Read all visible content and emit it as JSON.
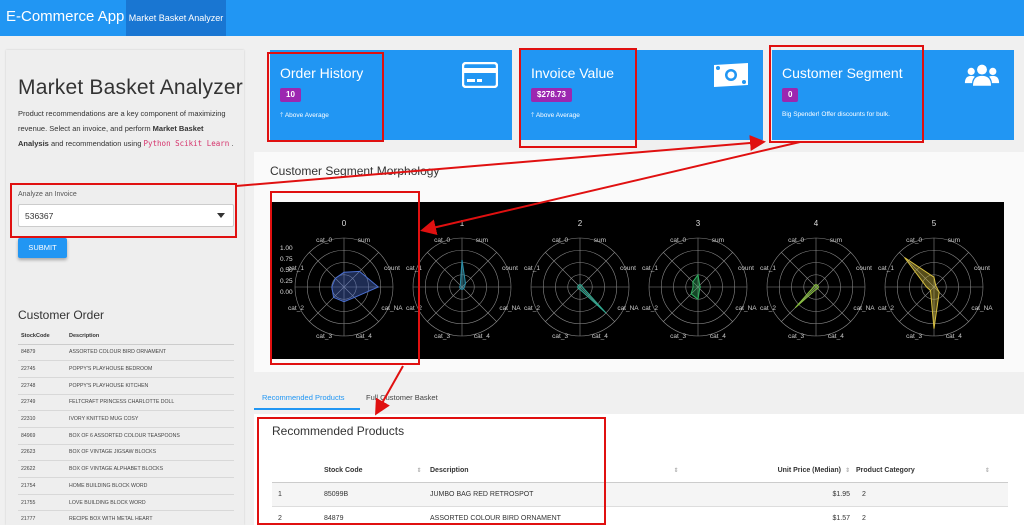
{
  "appbar": {
    "title": "E-Commerce App",
    "active_tab": "Market Basket Analyzer"
  },
  "sidebar": {
    "title": "Market Basket Analyzer",
    "desc_part1": "Product recommendations are a key component of maximizing revenue. Select an invoice, and perform ",
    "desc_bold": "Market Basket Analysis",
    "desc_part2": " and recommendation using ",
    "desc_code": "Python Scikit Learn",
    "desc_end": ".",
    "analyze_label": "Analyze an Invoice",
    "invoice_value": "536367",
    "submit_label": "SUBMIT",
    "order_title": "Customer Order",
    "order_headers": [
      "StockCode",
      "Description"
    ],
    "order_rows": [
      [
        "84879",
        "ASSORTED COLOUR BIRD ORNAMENT"
      ],
      [
        "22745",
        "POPPY'S PLAYHOUSE BEDROOM"
      ],
      [
        "22748",
        "POPPY'S PLAYHOUSE KITCHEN"
      ],
      [
        "22749",
        "FELTCRAFT PRINCESS CHARLOTTE DOLL"
      ],
      [
        "22310",
        "IVORY KNITTED MUG COSY"
      ],
      [
        "84969",
        "BOX OF 6 ASSORTED COLOUR TEASPOONS"
      ],
      [
        "22623",
        "BOX OF VINTAGE JIGSAW BLOCKS"
      ],
      [
        "22622",
        "BOX OF VINTAGE ALPHABET BLOCKS"
      ],
      [
        "21754",
        "HOME BUILDING BLOCK WORD"
      ],
      [
        "21755",
        "LOVE BUILDING BLOCK WORD"
      ],
      [
        "21777",
        "RECIPE BOX WITH METAL HEART"
      ]
    ]
  },
  "cards": [
    {
      "title": "Order History",
      "badge": "10",
      "sub": "Above Average",
      "icon": "credit-card-icon"
    },
    {
      "title": "Invoice Value",
      "badge": "$278.73",
      "sub": "Above Average",
      "icon": "money-icon"
    },
    {
      "title": "Customer Segment",
      "badge": "0",
      "sub": "Big Spender! Offer discounts for bulk.",
      "icon": "users-icon"
    }
  ],
  "morphology": {
    "title": "Customer Segment Morphology",
    "axes": [
      "count",
      "sum",
      "cat_0",
      "cat_1",
      "cat_2",
      "cat_3",
      "cat_4",
      "cat_NA"
    ],
    "ticks": [
      "1.00",
      "0.75",
      "0.50",
      "0.25",
      "0.00"
    ],
    "segments": [
      {
        "label": "0",
        "color": "#4a6fd0",
        "values": [
          0.7,
          0.45,
          0.3,
          0.25,
          0.25,
          0.3,
          0.3,
          0.3
        ]
      },
      {
        "label": "1",
        "color": "#2a8fa8",
        "values": [
          0.05,
          0.1,
          0.55,
          0.05,
          0.05,
          0.05,
          0.05,
          0.05
        ]
      },
      {
        "label": "2",
        "color": "#2fa890",
        "values": [
          0.05,
          0.05,
          0.05,
          0.05,
          0.05,
          0.05,
          0.05,
          0.75
        ]
      },
      {
        "label": "3",
        "color": "#2fb060",
        "values": [
          0.05,
          0.05,
          0.25,
          0.15,
          0.1,
          0.2,
          0.25,
          0.05
        ]
      },
      {
        "label": "4",
        "color": "#8ac040",
        "values": [
          0.05,
          0.05,
          0.05,
          0.05,
          0.05,
          0.6,
          0.05,
          0.05
        ]
      },
      {
        "label": "5",
        "color": "#d8c040",
        "values": [
          0.05,
          0.05,
          0.2,
          0.85,
          0.15,
          0.1,
          0.85,
          0.15
        ]
      }
    ]
  },
  "tabs": {
    "recommended": "Recommended Products",
    "full_basket": "Full Customer Basket"
  },
  "recommended": {
    "title": "Recommended Products",
    "headers": [
      "",
      "Stock Code",
      "Description",
      "Unit Price (Median)",
      "Product Category"
    ],
    "rows": [
      [
        "1",
        "85099B",
        "JUMBO BAG RED RETROSPOT",
        "$1.95",
        "2"
      ],
      [
        "2",
        "84879",
        "ASSORTED COLOUR BIRD ORNAMENT",
        "$1.57",
        "2"
      ]
    ]
  },
  "colors": {
    "primary": "#2196f3",
    "primary_dark": "#1976d2",
    "badge": "#9c27b0",
    "annotation": "#e01010"
  }
}
